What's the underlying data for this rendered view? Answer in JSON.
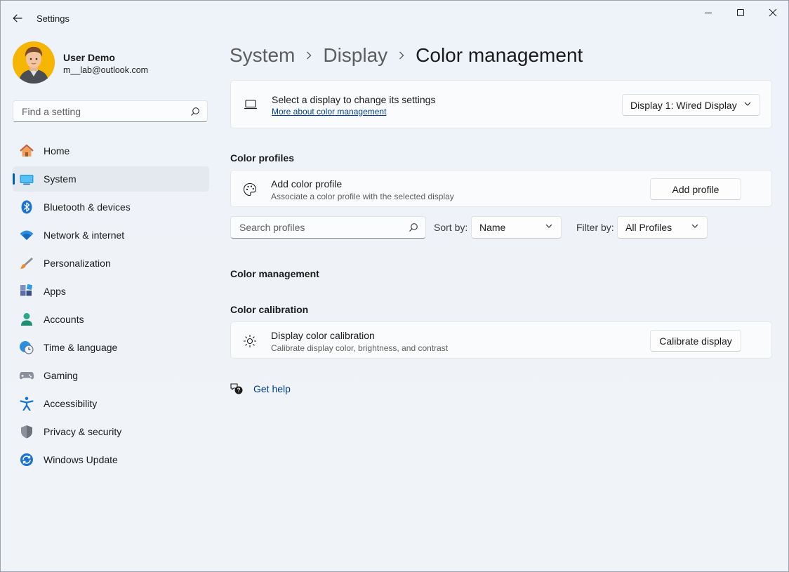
{
  "window": {
    "title": "Settings"
  },
  "user": {
    "name": "User Demo",
    "email": "m__lab@outlook.com"
  },
  "search": {
    "placeholder": "Find a setting"
  },
  "nav": {
    "items": [
      {
        "label": "Home",
        "icon": "home-icon"
      },
      {
        "label": "System",
        "icon": "system-icon",
        "active": true
      },
      {
        "label": "Bluetooth & devices",
        "icon": "bluetooth-icon"
      },
      {
        "label": "Network & internet",
        "icon": "wifi-icon"
      },
      {
        "label": "Personalization",
        "icon": "brush-icon"
      },
      {
        "label": "Apps",
        "icon": "apps-icon"
      },
      {
        "label": "Accounts",
        "icon": "accounts-icon"
      },
      {
        "label": "Time & language",
        "icon": "clock-globe-icon"
      },
      {
        "label": "Gaming",
        "icon": "gamepad-icon"
      },
      {
        "label": "Accessibility",
        "icon": "accessibility-icon"
      },
      {
        "label": "Privacy & security",
        "icon": "shield-icon"
      },
      {
        "label": "Windows Update",
        "icon": "update-icon"
      }
    ]
  },
  "breadcrumb": [
    "System",
    "Display",
    "Color management"
  ],
  "display_card": {
    "title": "Select a display to change its settings",
    "link": "More about color management",
    "dropdown_value": "Display 1: Wired Display"
  },
  "sections": {
    "color_profiles": "Color profiles",
    "color_management": "Color management",
    "color_calibration": "Color calibration"
  },
  "add_profile_card": {
    "title": "Add color profile",
    "subtitle": "Associate a color profile with the selected display",
    "button": "Add profile"
  },
  "profiles_toolbar": {
    "search_placeholder": "Search profiles",
    "sort_label": "Sort by:",
    "sort_value": "Name",
    "filter_label": "Filter by:",
    "filter_value": "All Profiles"
  },
  "calibration_card": {
    "title": "Display color calibration",
    "subtitle": "Calibrate display color, brightness, and contrast",
    "button": "Calibrate display"
  },
  "help": {
    "label": "Get help"
  },
  "colors": {
    "accent": "#005fb8",
    "link": "#003e92"
  }
}
